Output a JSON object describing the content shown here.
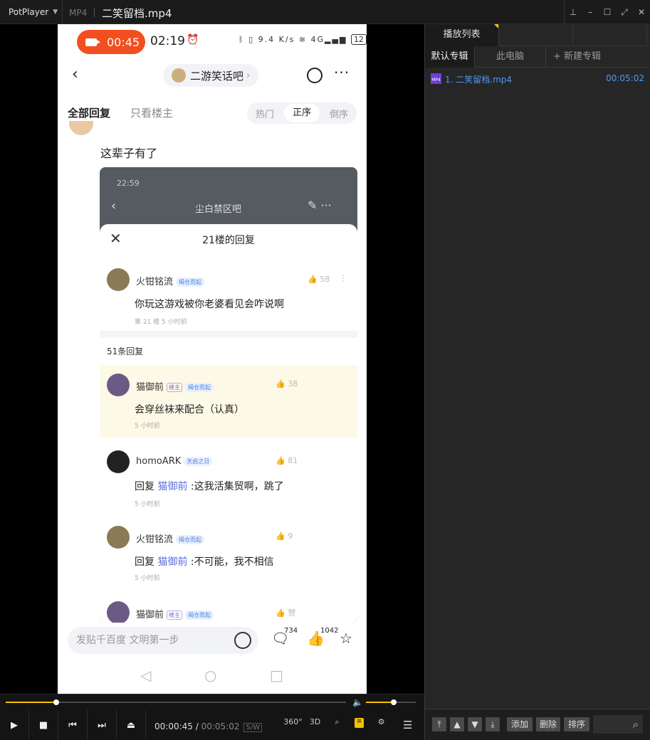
{
  "titlebar": {
    "app": "PotPlayer",
    "format": "MP4",
    "title": "二笑留档.mp4"
  },
  "phone": {
    "record_time": "00:45",
    "clock": "02:19",
    "net_speed": "9.4 K/s",
    "battery": "12",
    "forum_name": "二游笑话吧",
    "tabs": {
      "all": "全部回复",
      "op_only": "只看楼主"
    },
    "sort": [
      "热门",
      "正序",
      "倒序"
    ],
    "sort_selected": "正序",
    "reply_text": "这辈子有了",
    "embedded": {
      "time": "22:59",
      "forum": "尘白禁区吧",
      "sheet_title": "21楼的回复",
      "main": {
        "user": "火钳铭流",
        "badge": "揭仓而起",
        "likes": "58",
        "text": "你玩这游戏被你老婆看见会咋说啊",
        "meta": "第 21 楼  5 小时前"
      },
      "count": "51条回复",
      "replies": [
        {
          "user": "猫御前",
          "owner": "楼主",
          "badge": "揭仓而起",
          "likes": "38",
          "text": "会穿丝袜来配合（认真）",
          "time": "5 小时前"
        },
        {
          "user": "homoARK",
          "badge": "天启之日",
          "likes": "81",
          "reply_prefix": "回复",
          "reply_to": "猫御前",
          "text": ":这我活集贸啊",
          "text2": "，跳了",
          "time": "5 小时前"
        },
        {
          "user": "火钳铭流",
          "badge": "揭仓而起",
          "likes": "9",
          "reply_prefix": "回复",
          "reply_to": "猫御前",
          "text": ":不可能，我不相信",
          "time": "5 小时前"
        },
        {
          "user": "猫御前",
          "owner": "楼主",
          "badge": "揭仓而起",
          "likes": "赞"
        }
      ]
    },
    "input_placeholder": "发贴千百度 文明第一步",
    "comment_count": "734",
    "like_count": "1042"
  },
  "controls": {
    "progress": 0.149,
    "volume": 0.56,
    "current_time": "00:00:45",
    "total_time": "00:05:02",
    "sw_label": "S/W",
    "label_360": "360°",
    "label_3d": "3D"
  },
  "playlist": {
    "tabs": [
      "播放列表",
      "",
      ""
    ],
    "albums": [
      "默认专辑",
      "此电脑",
      "+ 新建专辑"
    ],
    "items": [
      {
        "name": "1. 二笑留档.mp4",
        "duration": "00:05:02"
      }
    ],
    "buttons": [
      "添加",
      "删除",
      "排序"
    ]
  }
}
